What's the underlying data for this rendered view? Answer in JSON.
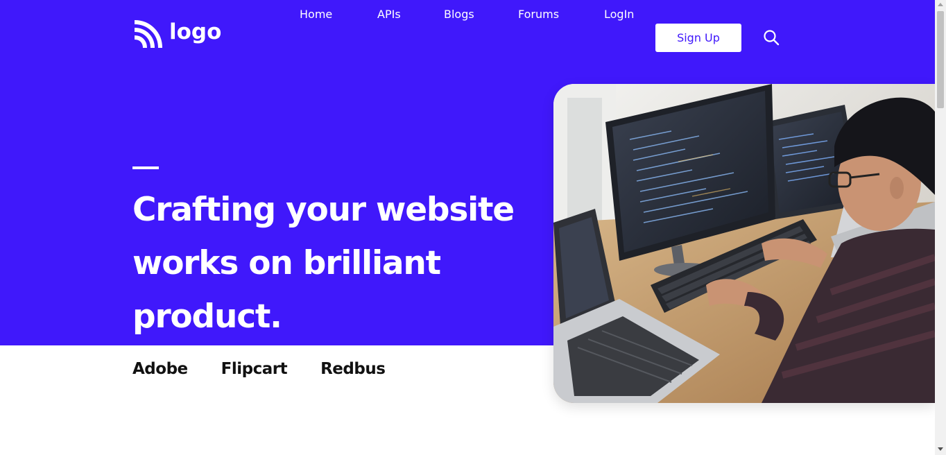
{
  "brand": {
    "logo_text": "logo",
    "accent_color": "#4018fb"
  },
  "nav": {
    "items": [
      {
        "label": "Home"
      },
      {
        "label": "APIs"
      },
      {
        "label": "Blogs"
      },
      {
        "label": "Forums"
      },
      {
        "label": "LogIn"
      }
    ],
    "signup_label": "Sign Up",
    "search_icon": "search-icon"
  },
  "hero": {
    "headline_lines": [
      "Crafting your website",
      "works on brilliant",
      "product."
    ]
  },
  "partners": [
    "Adobe",
    "Flipcart",
    "Redbus"
  ]
}
